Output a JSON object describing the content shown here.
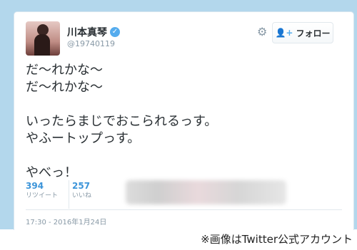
{
  "profile": {
    "display_name": "川本真琴",
    "handle": "@19740119",
    "verified": true,
    "avatar_icon": "user-avatar"
  },
  "header": {
    "settings_icon": "gear-icon",
    "follow_label": "フォロー",
    "follow_icon": "add-user-icon"
  },
  "tweet": {
    "text": "だ〜れかな〜\nだ〜れかな〜\n\nいったらまじでおこられるっす。\nやふートップっす。\n\nやべっ！",
    "retweets": "394",
    "retweets_label": "リツイート",
    "likes": "257",
    "likes_label": "いいね",
    "timestamp": "17:30 - 2016年1月24日"
  },
  "footer": {
    "credit": "※画像はTwitter公式アカウント"
  },
  "colors": {
    "frame": "#b3d7ec",
    "link": "#3b94d9",
    "muted": "#8899a6",
    "text": "#292f33",
    "verified": "#55acee"
  }
}
